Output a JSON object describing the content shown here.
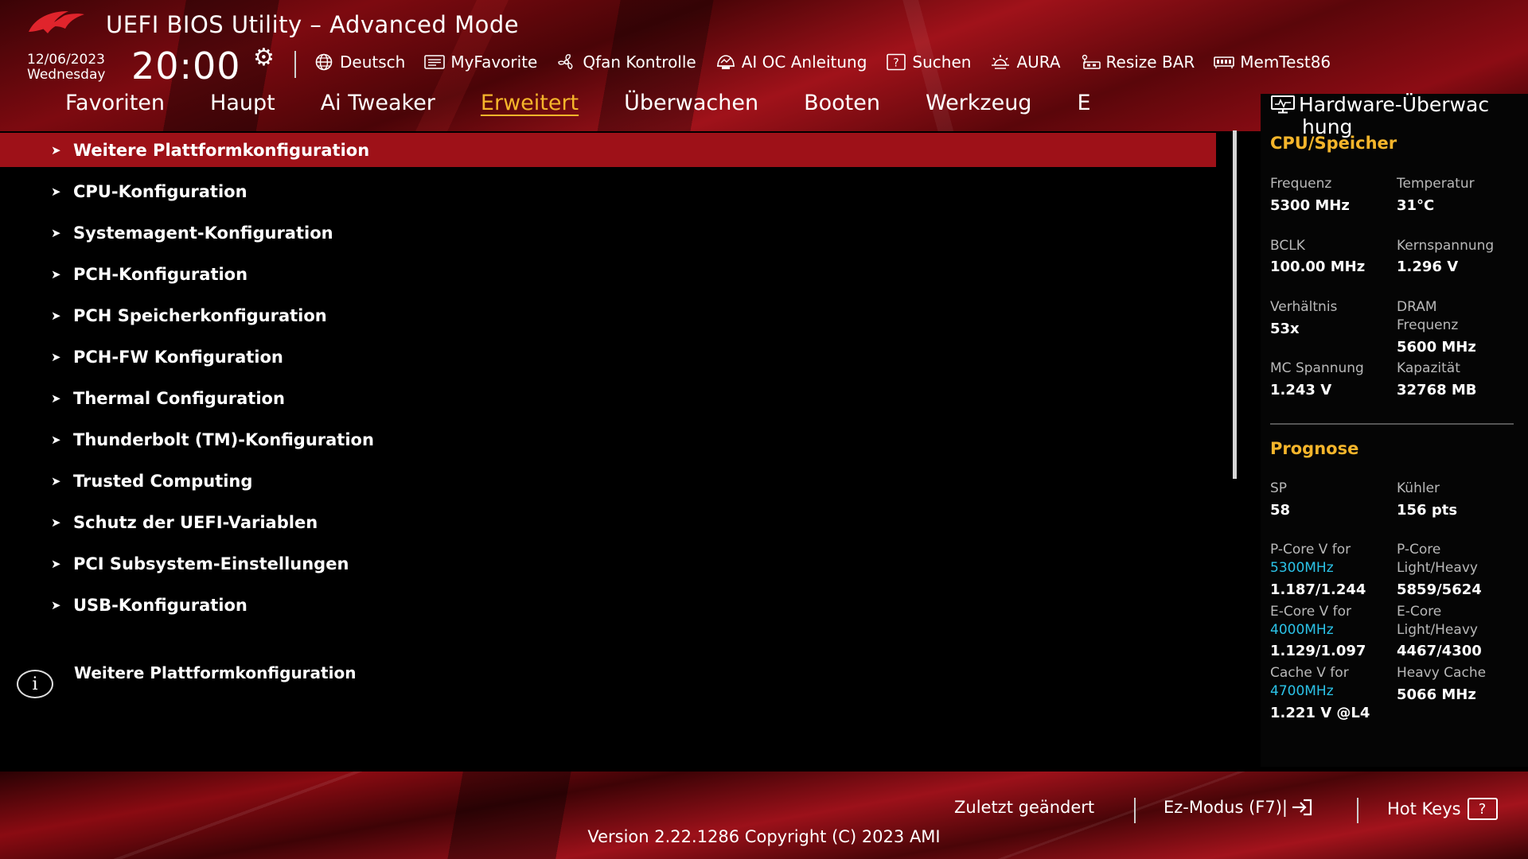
{
  "header": {
    "title": "UEFI BIOS Utility – Advanced Mode",
    "date": "12/06/2023",
    "weekday": "Wednesday",
    "time": "20:00"
  },
  "toolbar": [
    {
      "label": "Deutsch",
      "icon": "globe-icon"
    },
    {
      "label": "MyFavorite",
      "icon": "favorite-list-icon"
    },
    {
      "label": "Qfan Kontrolle",
      "icon": "fan-icon"
    },
    {
      "label": "AI OC Anleitung",
      "icon": "ai-oc-icon"
    },
    {
      "label": "Suchen",
      "icon": "search-help-icon"
    },
    {
      "label": "AURA",
      "icon": "aura-icon"
    },
    {
      "label": "Resize BAR",
      "icon": "resize-bar-icon"
    },
    {
      "label": "MemTest86",
      "icon": "memory-icon"
    }
  ],
  "tabs": [
    {
      "label": "Favoriten",
      "active": false
    },
    {
      "label": "Haupt",
      "active": false
    },
    {
      "label": "Ai Tweaker",
      "active": false
    },
    {
      "label": "Erweitert",
      "active": true
    },
    {
      "label": "Überwachen",
      "active": false
    },
    {
      "label": "Booten",
      "active": false
    },
    {
      "label": "Werkzeug",
      "active": false
    },
    {
      "label": "E",
      "active": false
    }
  ],
  "menu": [
    {
      "label": "Weitere Plattformkonfiguration",
      "selected": true
    },
    {
      "label": "CPU-Konfiguration",
      "selected": false
    },
    {
      "label": "Systemagent-Konfiguration",
      "selected": false
    },
    {
      "label": "PCH-Konfiguration",
      "selected": false
    },
    {
      "label": "PCH Speicherkonfiguration",
      "selected": false
    },
    {
      "label": "PCH-FW Konfiguration",
      "selected": false
    },
    {
      "label": "Thermal Configuration",
      "selected": false
    },
    {
      "label": "Thunderbolt (TM)-Konfiguration",
      "selected": false
    },
    {
      "label": "Trusted Computing",
      "selected": false
    },
    {
      "label": "Schutz der UEFI-Variablen",
      "selected": false
    },
    {
      "label": "PCI Subsystem-Einstellungen",
      "selected": false
    },
    {
      "label": "USB-Konfiguration",
      "selected": false
    }
  ],
  "info": {
    "text": "Weitere Plattformkonfiguration"
  },
  "hw": {
    "title_line1": "Hardware-Überwac",
    "title_line2": "hung",
    "cpu_section": "CPU/Speicher",
    "freq_label": "Frequenz",
    "freq_value": "5300 MHz",
    "temp_label": "Temperatur",
    "temp_value": "31°C",
    "bclk_label": "BCLK",
    "bclk_value": "100.00 MHz",
    "vcore_label": "Kernspannung",
    "vcore_value": "1.296 V",
    "ratio_label": "Verhältnis",
    "ratio_value": "53x",
    "dram_label1": "DRAM",
    "dram_label2": "Frequenz",
    "dram_value": "5600 MHz",
    "mc_label": "MC Spannung",
    "mc_value": "1.243 V",
    "cap_label": "Kapazität",
    "cap_value": "32768 MB",
    "prog_section": "Prognose",
    "sp_label": "SP",
    "sp_value": "58",
    "cooler_label": "Kühler",
    "cooler_value": "156 pts",
    "pcore_label": "P-Core V for",
    "pcore_freq": "5300MHz",
    "pcore_value": "1.187/1.244",
    "pcore_lh_label1": "P-Core",
    "pcore_lh_label2": "Light/Heavy",
    "pcore_lh_value": "5859/5624",
    "ecore_label": "E-Core V for",
    "ecore_freq": "4000MHz",
    "ecore_value": "1.129/1.097",
    "ecore_lh_label1": "E-Core",
    "ecore_lh_label2": "Light/Heavy",
    "ecore_lh_value": "4467/4300",
    "cache_label": "Cache V for",
    "cache_freq": "4700MHz",
    "cache_value": "1.221 V @L4",
    "hcache_label": "Heavy Cache",
    "hcache_value": "5066 MHz"
  },
  "bottom": {
    "last_changed": "Zuletzt geändert",
    "ez_mode": "Ez-Modus (F7)|",
    "hot_keys": "Hot Keys",
    "help_glyph": "?",
    "version": "Version 2.22.1286 Copyright (C) 2023 AMI"
  },
  "colors": {
    "accent": "#f5b52b",
    "selection": "#9e1118",
    "frequency": "#2bc3e8"
  }
}
